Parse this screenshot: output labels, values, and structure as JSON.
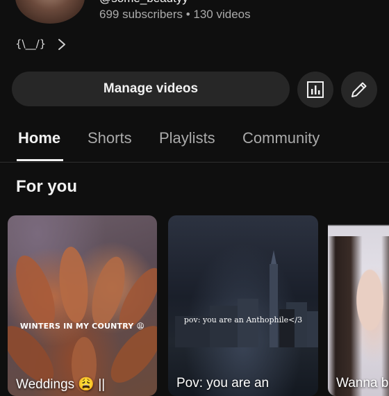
{
  "channel": {
    "handle": "@some_beautyy",
    "stats": "699 subscribers • 130 videos",
    "bio": "{\\__/}"
  },
  "actions": {
    "manage_label": "Manage videos"
  },
  "icons": {
    "bio_more": "chevron-right-icon",
    "analytics": "bar-chart-icon",
    "edit": "pencil-icon"
  },
  "tabs": [
    {
      "label": "Home",
      "active": true
    },
    {
      "label": "Shorts",
      "active": false
    },
    {
      "label": "Playlists",
      "active": false
    },
    {
      "label": "Community",
      "active": false
    }
  ],
  "section": {
    "title": "For you"
  },
  "shorts": [
    {
      "overlay": "WINTERS IN MY COUNTRY 😩",
      "title": "Weddings 😩 ||"
    },
    {
      "overlay": "pov: you are an Anthophile</3",
      "title": "Pov: you are an"
    },
    {
      "overlay": "",
      "title": "Wanna b"
    }
  ],
  "colors": {
    "background": "#0f0f0f",
    "button": "#272727",
    "text_primary": "#f1f1f1",
    "text_secondary": "#aaaaaa"
  }
}
